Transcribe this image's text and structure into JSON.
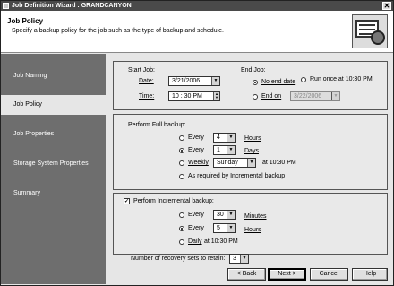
{
  "window": {
    "title": "Job Definition Wizard : GRANDCANYON",
    "close_glyph": "✕"
  },
  "header": {
    "title": "Job Policy",
    "description": "Specify a backup policy for the job such as the type of backup and schedule.",
    "icon": "backup-policy-icon"
  },
  "sidebar": {
    "items": [
      {
        "label": "Job Naming",
        "active": false
      },
      {
        "label": "Job Policy",
        "active": true
      },
      {
        "label": "Job Properties",
        "active": false
      },
      {
        "label": "Storage System Properties",
        "active": false
      },
      {
        "label": "Summary",
        "active": false
      }
    ]
  },
  "start_job": {
    "label": "Start Job:",
    "date_label": "Date:",
    "date_value": "3/21/2006",
    "time_label": "Time:",
    "time_value": "10 : 30  PM"
  },
  "end_job": {
    "label": "End Job:",
    "no_end_label": "No end date",
    "run_once_label": "Run once at 10:30 PM",
    "end_on_label": "End on",
    "end_on_value": "3/22/2006",
    "selected": "no_end"
  },
  "full_backup": {
    "label": "Perform Full backup:",
    "every_label": "Every",
    "hours_value": "4",
    "hours_unit": "Hours",
    "days_value": "1",
    "days_unit": "Days",
    "weekly_label": "Weekly",
    "weekly_day": "Sunday",
    "weekly_time": "at 10:30 PM",
    "as_required_label": "As required by Incremental backup",
    "selected": "days"
  },
  "incremental_backup": {
    "label": "Perform Incremental backup:",
    "checked": true,
    "every_label": "Every",
    "minutes_value": "30",
    "minutes_unit": "Minutes",
    "hours_value": "5",
    "hours_unit": "Hours",
    "daily_label": "Daily",
    "daily_time": "at 10:30 PM",
    "selected": "hours"
  },
  "recovery": {
    "label": "Number of recovery sets to retain:",
    "value": "3"
  },
  "buttons": {
    "back": "< Back",
    "next": "Next >",
    "cancel": "Cancel",
    "help": "Help"
  },
  "colors": {
    "sidebar": "#6e6e6e",
    "titlebar": "#4a4a4a",
    "content": "#e6e6e6"
  }
}
